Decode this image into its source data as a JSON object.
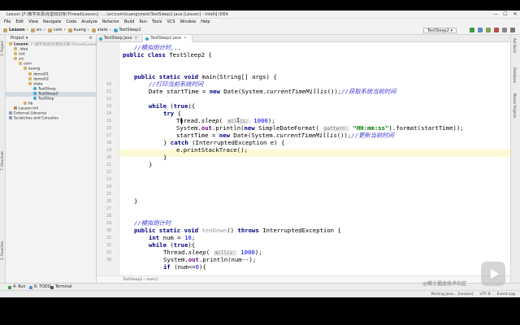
{
  "window": {
    "title": "Lesson [F:\\教学资源\\完善知识库\\Thread\\Lesson] - ...\\src\\com\\kuang\\state\\TestSleep2.java [Lesson] - IntelliJ IDEA",
    "controls": [
      "—",
      "☐",
      "✕"
    ]
  },
  "menu": [
    "File",
    "Edit",
    "View",
    "Navigate",
    "Code",
    "Analyze",
    "Refactor",
    "Build",
    "Run",
    "Tools",
    "VCS",
    "Window",
    "Help"
  ],
  "toolbar": {
    "breadcrumbs": [
      "Lesson",
      "src",
      "com",
      "kuang",
      "state",
      "TestSleep2"
    ],
    "run_config": "TestSleep2 ▾"
  },
  "left_strip": {
    "project": "1: Project",
    "structure": "7: Structure",
    "favorites": "2: Favorites"
  },
  "project_panel": {
    "title": "Project ▾",
    "tree": [
      {
        "label": "Lesson",
        "path": "F:\\教学资源\\完善知识库\\Thread\\Lesson",
        "indent": 0,
        "icon": "folder-icon",
        "bold": true
      },
      {
        "label": ".idea",
        "indent": 1,
        "icon": "folder-icon"
      },
      {
        "label": "out",
        "indent": 1,
        "icon": "folder-icon"
      },
      {
        "label": "src",
        "indent": 1,
        "icon": "folder-icon"
      },
      {
        "label": "com",
        "indent": 2,
        "icon": "folder-icon"
      },
      {
        "label": "kuang",
        "indent": 3,
        "icon": "folder-icon"
      },
      {
        "label": "demo01",
        "indent": 4,
        "icon": "folder-icon"
      },
      {
        "label": "demo02",
        "indent": 4,
        "icon": "folder-icon"
      },
      {
        "label": "state",
        "indent": 4,
        "icon": "folder-icon"
      },
      {
        "label": "TestSleep",
        "indent": 5,
        "icon": "java-class-icon"
      },
      {
        "label": "TestSleep2",
        "indent": 5,
        "icon": "java-class-icon",
        "selected": true
      },
      {
        "label": "TestStop",
        "indent": 5,
        "icon": "java-class-icon"
      },
      {
        "label": "lib",
        "indent": 3,
        "icon": "folder-icon"
      },
      {
        "label": "Lesson.iml",
        "indent": 1,
        "icon": "iml-file-icon"
      },
      {
        "label": "External Libraries",
        "indent": 0,
        "icon": "library-icon"
      },
      {
        "label": "Scratches and Consoles",
        "indent": 0,
        "icon": "scratches-icon"
      }
    ]
  },
  "editor": {
    "tabs": [
      {
        "label": "TestSleep.java",
        "active": false
      },
      {
        "label": "TestSleep2.java",
        "active": true
      }
    ],
    "line_numbers": [
      "",
      "",
      "",
      "",
      "",
      "10",
      "11",
      "12",
      "13",
      "14",
      "15",
      "16",
      "17",
      "18",
      "19",
      "20",
      "21",
      "22",
      "23",
      "24",
      "25",
      "26",
      "27",
      "28",
      "29",
      "30",
      "31",
      "32",
      "33",
      "34"
    ],
    "breadcrumb": "TestSleep2  ›  main()"
  },
  "code": {
    "l1": "//模拟倒计时,,,",
    "l2_kw": "public class",
    "l2_rest": " TestSleep2 {",
    "l5_kw": "public static void",
    "l5_rest": " main(String[] args) {",
    "l6": "//打印当前系统时间",
    "l7a": "Date startTime = ",
    "l7kw": "new",
    "l7b": " Date(System.",
    "l7fn": "currentTimeMillis",
    "l7c": "());",
    "l7cm": "//获取系统当前时间",
    "l9kw": "while",
    "l9b": " (",
    "l9kw2": "true",
    "l9c": "){",
    "l10kw": "try",
    "l10b": " {",
    "l11a": "Thread.",
    "l11fn": "sleep",
    "l11b": "( ",
    "l11hint": "millis:",
    "l11num": " 1000",
    "l11c": ");",
    "l12a": "System.",
    "l12fld": "out",
    "l12b": ".println(",
    "l12kw": "new",
    "l12c": " SimpleDateFormat( ",
    "l12hint": "pattern:",
    "l12st": " \"HH:mm:ss\"",
    "l12d": ").format(startTime));",
    "l13a": "startTime = ",
    "l13kw": "new",
    "l13b": " Date(System.",
    "l13fn": "currentTimeMillis",
    "l13c": "());",
    "l13cm": "//更新当前时间",
    "l14a": "} ",
    "l14kw": "catch",
    "l14b": " (InterruptedException e) {",
    "l15": "e.printStackTrace();",
    "l16": "}",
    "l17": "}",
    "l22": "}",
    "l25": "//模拟倒计时",
    "l26kw": "public static void",
    "l26un": " tenDown",
    "l26b": "() ",
    "l26kw2": "throws",
    "l26c": " InterruptedException {",
    "l27kw": "int",
    "l27b": " num = ",
    "l27num": "10",
    "l27c": ";",
    "l28kw": "while",
    "l28b": " (",
    "l28kw2": "true",
    "l28c": "){",
    "l29a": "Thread.",
    "l29fn": "sleep",
    "l29b": "( ",
    "l29hint": "millis:",
    "l29num": " 1000",
    "l29c": ");",
    "l30a": "System.",
    "l30fld": "out",
    "l30b": ".println(num--);",
    "l31kw": "if",
    "l31b": " (num<=",
    "l31num": "0",
    "l31c": "){"
  },
  "right_strip": {
    "ant": "Ant Build",
    "database": "Database",
    "maven": "Maven Projects"
  },
  "bottom_tools": {
    "run": "4: Run",
    "todo": "6: TODO",
    "terminal": "Terminal"
  },
  "status": {
    "parsing": "Parsing java... [Lesson]",
    "encoding": "UTF-8",
    "git": "Event Log"
  },
  "watermark": "@稀土掘金技术社区"
}
